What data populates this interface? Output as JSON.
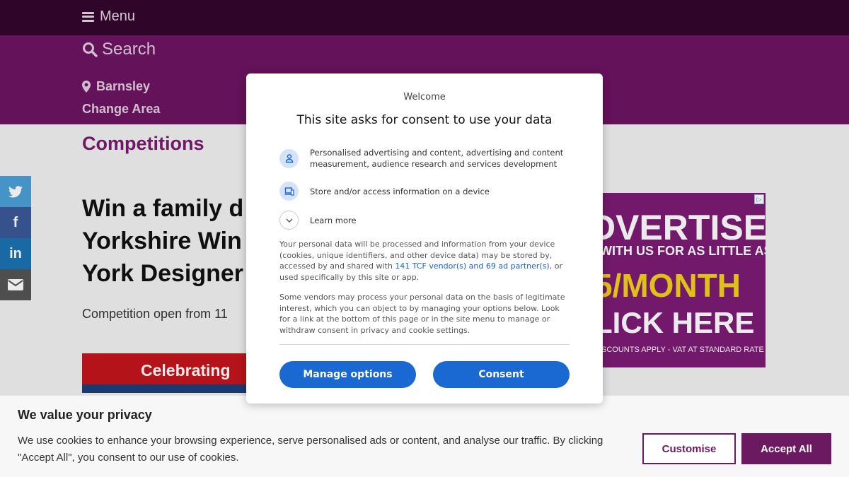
{
  "header": {
    "menu_label": "Menu",
    "search_label": "Search",
    "location": "Barnsley",
    "change_area": "Change Area"
  },
  "section_title": "Competitions",
  "article": {
    "headline_line1": "Win a family d",
    "headline_line2": "Yorkshire Win",
    "headline_line3": "York Designer",
    "competition_open": "Competition open from 11",
    "banner_text": "Celebrating"
  },
  "share": {
    "twitter": "t",
    "facebook": "f",
    "linkedin": "in",
    "email": "✉"
  },
  "ad": {
    "line1": "DVERTISE",
    "line2": "WITH US FOR AS LITTLE AS",
    "line3": "5/MONTH",
    "line4": "LICK HERE",
    "line5": "SCOUNTS APPLY - VAT AT STANDARD RATE",
    "adchoices": "▷"
  },
  "consent_modal": {
    "welcome": "Welcome",
    "title": "This site asks for consent to use your data",
    "purposes": [
      {
        "icon": "person-icon",
        "label": "Personalised advertising and content, advertising and content measurement, audience research and services development"
      },
      {
        "icon": "device-icon",
        "label": "Store and/or access information on a device"
      }
    ],
    "learn_more": "Learn more",
    "para1_before": "Your personal data will be processed and information from your device (cookies, unique identifiers, and other device data) may be stored by, accessed by and shared with ",
    "para1_link": "141 TCF vendor(s) and 69 ad partner(s)",
    "para1_after": ", or used specifically by this site or app.",
    "para2": "Some vendors may process your personal data on the basis of legitimate interest, which you can object to by managing your options below. Look for a link at the bottom of this page or in the site menu to manage or withdraw consent in privacy and cookie settings.",
    "manage_options": "Manage options",
    "consent": "Consent"
  },
  "privacy_bar": {
    "title": "We value your privacy",
    "text": "We use cookies to enhance your browsing experience, serve personalised ads or content, and analyse our traffic. By clicking \"Accept All\", you consent to our use of cookies.",
    "customise": "Customise",
    "accept_all": "Accept All"
  },
  "colors": {
    "topbar": "#33062e",
    "header_purple": "#6d1462",
    "brand_purple": "#6b1a62",
    "consent_blue": "#1a68d1"
  }
}
